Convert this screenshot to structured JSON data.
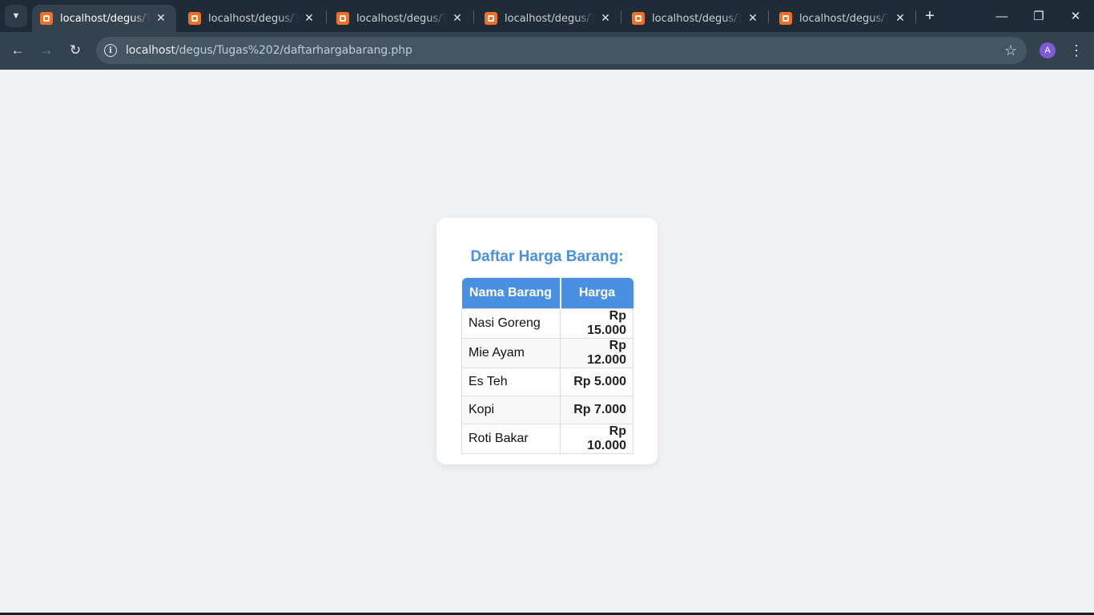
{
  "browser": {
    "tabs": [
      {
        "title": "localhost/degus/Tugas",
        "active": true
      },
      {
        "title": "localhost/degus/Tugas",
        "active": false
      },
      {
        "title": "localhost/degus/Tugas",
        "active": false
      },
      {
        "title": "localhost/degus/Tugas",
        "active": false
      },
      {
        "title": "localhost/degus/Tugas",
        "active": false
      },
      {
        "title": "localhost/degus/Tugas",
        "active": false
      }
    ],
    "url_host": "localhost",
    "url_path": "/degus/Tugas%202/daftarhargabarang.php",
    "profile_initial": "A"
  },
  "page": {
    "title": "Daftar Harga Barang:",
    "columns": [
      "Nama Barang",
      "Harga"
    ],
    "rows": [
      {
        "name": "Nasi Goreng",
        "price": "Rp 15.000"
      },
      {
        "name": "Mie Ayam",
        "price": "Rp 12.000"
      },
      {
        "name": "Es Teh",
        "price": "Rp 5.000"
      },
      {
        "name": "Kopi",
        "price": "Rp 7.000"
      },
      {
        "name": "Roti Bakar",
        "price": "Rp 10.000"
      }
    ]
  },
  "colors": {
    "accent": "#4a90e2",
    "page_bg": "#f0f2f5",
    "chrome_dark": "#1f2b36",
    "chrome_toolbar": "#34424f"
  }
}
